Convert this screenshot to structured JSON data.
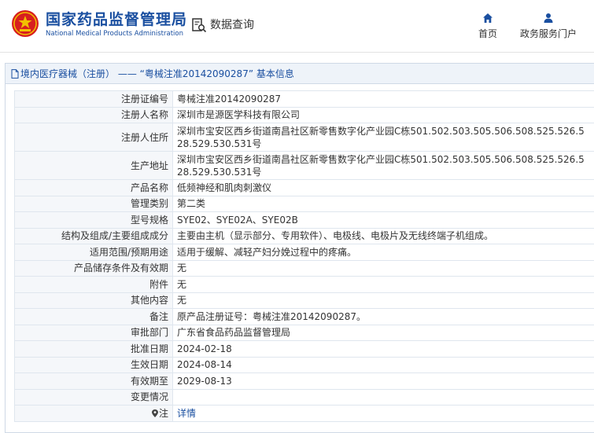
{
  "header": {
    "brand_cn": "国家药品监督管理局",
    "brand_en": "National Medical Products Administration",
    "query_label": "数据查询",
    "nav": [
      {
        "label": "首页",
        "icon": "home-icon"
      },
      {
        "label": "政务服务门户",
        "icon": "user-icon"
      }
    ]
  },
  "title_bar": {
    "text": "境内医疗器械（注册） —— “粤械注准20142090287” 基本信息",
    "icon": "document-icon"
  },
  "colors": {
    "brand_blue": "#1a4fa0",
    "label_bg": "#f5f7fa",
    "title_bg": "#eef3f9",
    "border": "#dfe6ee",
    "emblem_red": "#d71f1f",
    "emblem_gold": "#f2c200"
  },
  "details": [
    {
      "label": "注册证编号",
      "value": "粤械注准20142090287"
    },
    {
      "label": "注册人名称",
      "value": "深圳市是源医学科技有限公司"
    },
    {
      "label": "注册人住所",
      "value": "深圳市宝安区西乡街道南昌社区新零售数字化产业园C栋501.502.503.505.506.508.525.526.528.529.530.531号"
    },
    {
      "label": "生产地址",
      "value": "深圳市宝安区西乡街道南昌社区新零售数字化产业园C栋501.502.503.505.506.508.525.526.528.529.530.531号"
    },
    {
      "label": "产品名称",
      "value": "低频神经和肌肉刺激仪"
    },
    {
      "label": "管理类别",
      "value": "第二类"
    },
    {
      "label": "型号规格",
      "value": "SYE02、SYE02A、SYE02B"
    },
    {
      "label": "结构及组成/主要组成成分",
      "value": "主要由主机（显示部分、专用软件）、电极线、电极片及无线终端子机组成。"
    },
    {
      "label": "适用范围/预期用途",
      "value": "适用于缓解、减轻产妇分娩过程中的疼痛。"
    },
    {
      "label": "产品储存条件及有效期",
      "value": "无"
    },
    {
      "label": "附件",
      "value": "无"
    },
    {
      "label": "其他内容",
      "value": "无"
    },
    {
      "label": "备注",
      "value": "原产品注册证号：粤械注准20142090287。"
    },
    {
      "label": "审批部门",
      "value": "广东省食品药品监督管理局"
    },
    {
      "label": "批准日期",
      "value": "2024-02-18"
    },
    {
      "label": "生效日期",
      "value": "2024-08-14"
    },
    {
      "label": "有效期至",
      "value": "2029-08-13"
    },
    {
      "label": "变更情况",
      "value": ""
    }
  ],
  "note": {
    "label": "注",
    "link": "详情",
    "icon": "pin-icon"
  }
}
